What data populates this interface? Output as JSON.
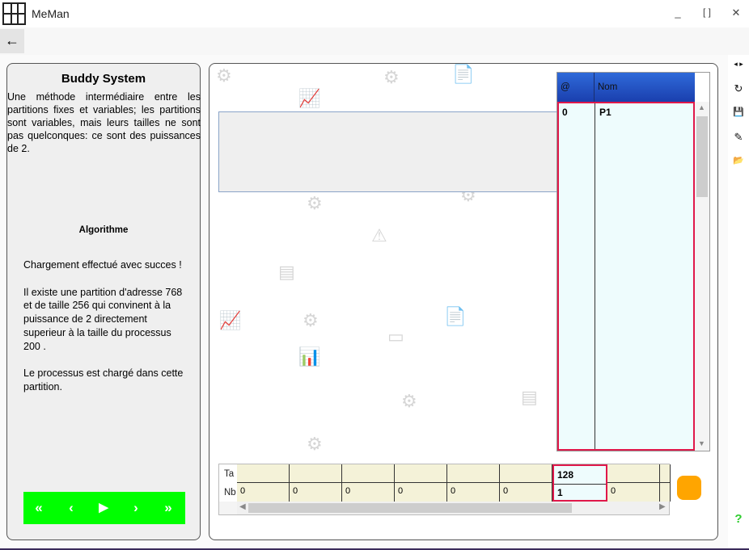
{
  "window": {
    "title": "MeMan",
    "minimize": "_",
    "maximize": "[ ]",
    "close": "✕"
  },
  "toolbar": {
    "back_glyph": "←"
  },
  "right_rail": {
    "collapse_glyph": "◂ ▸",
    "reset_glyph": "↻",
    "save_glyph": "💾",
    "edit_glyph": "✎",
    "open_glyph": "📂",
    "help_glyph": "?"
  },
  "left_panel": {
    "title": "Buddy System",
    "description": "Une méthode intermédiaire entre les partitions fixes et variables; les partitions sont variables, mais leurs tailles ne sont pas quelconques: ce sont des puissances de 2.",
    "algo_heading": "Algorithme",
    "log": "Chargement effectué avec succes !\n\nIl existe une partition d'adresse 768 et de taille 256 qui convinent à la puissance de 2 directement superieur à la taille du processus  200 .\n\nLe processus est chargé dans cette partition.",
    "player": {
      "first": "«",
      "prev": "‹",
      "play": "▶",
      "next": "›",
      "last": "»",
      "color": "#00ff00"
    }
  },
  "partition_table": {
    "columns": [
      "@",
      "Nom"
    ],
    "rows": [
      {
        "address": "0",
        "name": "P1"
      }
    ],
    "header_color": "#1f4fc4",
    "selection_color": "#e0184a"
  },
  "memory_grid": {
    "row_labels": [
      "Ta",
      "Nb"
    ],
    "cells": [
      {
        "ta": "",
        "nb": "0"
      },
      {
        "ta": "",
        "nb": "0"
      },
      {
        "ta": "",
        "nb": "0"
      },
      {
        "ta": "",
        "nb": "0"
      },
      {
        "ta": "",
        "nb": "0"
      },
      {
        "ta": "",
        "nb": "0"
      },
      {
        "ta": "128",
        "nb": "1",
        "active": true
      },
      {
        "ta": "",
        "nb": "0"
      },
      {
        "ta": "",
        "nb": ""
      }
    ]
  },
  "accent_color": "#ffa500"
}
